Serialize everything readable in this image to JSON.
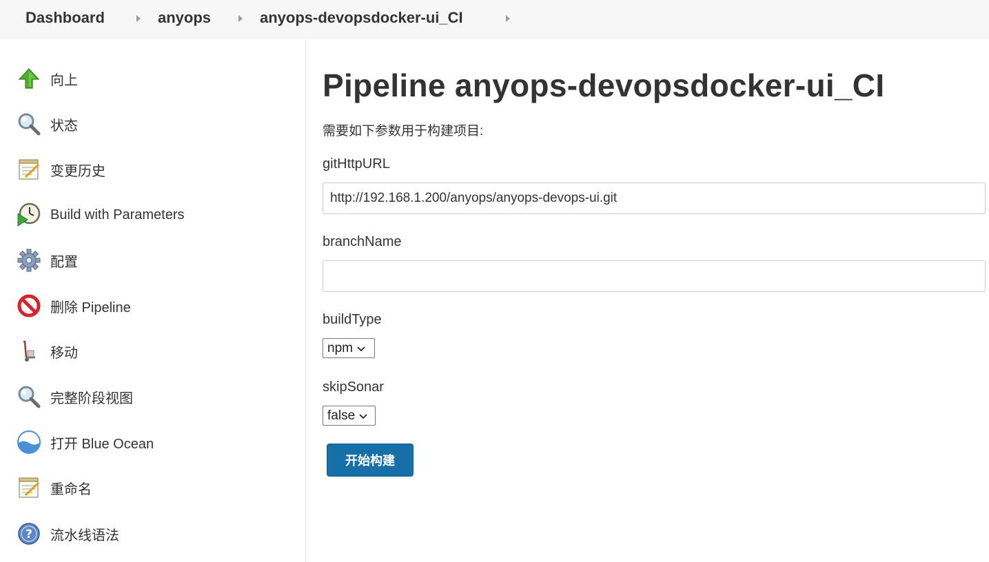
{
  "breadcrumb": {
    "items": [
      "Dashboard",
      "anyops",
      "anyops-devopsdocker-ui_CI"
    ]
  },
  "sidebar": {
    "items": [
      {
        "label": "向上",
        "icon": "up-arrow-icon"
      },
      {
        "label": "状态",
        "icon": "search-icon"
      },
      {
        "label": "变更历史",
        "icon": "notepad-icon"
      },
      {
        "label": "Build with Parameters",
        "icon": "clock-play-icon"
      },
      {
        "label": "配置",
        "icon": "gear-icon"
      },
      {
        "label": "删除 Pipeline",
        "icon": "no-entry-icon"
      },
      {
        "label": "移动",
        "icon": "hand-truck-icon"
      },
      {
        "label": "完整阶段视图",
        "icon": "search-icon"
      },
      {
        "label": "打开 Blue Ocean",
        "icon": "blue-ocean-icon"
      },
      {
        "label": "重命名",
        "icon": "notepad-icon"
      },
      {
        "label": "流水线语法",
        "icon": "help-icon"
      }
    ]
  },
  "main": {
    "title": "Pipeline anyops-devopsdocker-ui_CI",
    "description": "需要如下参数用于构建项目:",
    "params": {
      "gitHttpURL": {
        "label": "gitHttpURL",
        "value": "http://192.168.1.200/anyops/anyops-devops-ui.git"
      },
      "branchName": {
        "label": "branchName",
        "value": ""
      },
      "buildType": {
        "label": "buildType",
        "selected": "npm"
      },
      "skipSonar": {
        "label": "skipSonar",
        "selected": "false"
      }
    },
    "submit_label": "开始构建"
  },
  "colors": {
    "accent_button": "#176fa8",
    "breadcrumb_bg": "#f7f7f7",
    "text": "#333333"
  }
}
